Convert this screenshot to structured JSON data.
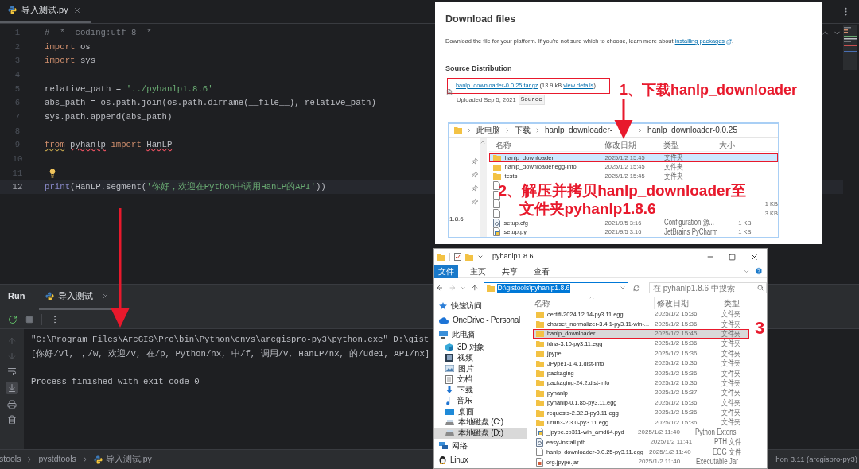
{
  "editor": {
    "tab": {
      "label": "导入测试.py"
    },
    "lines": [
      {
        "number": "1",
        "current": false,
        "hint": false,
        "tokens": [
          {
            "kind": "comment",
            "text": "# -*- coding:utf-8 -*-"
          }
        ]
      },
      {
        "number": "2",
        "current": false,
        "hint": false,
        "tokens": [
          {
            "kind": "keyword",
            "text": "import"
          },
          {
            "kind": "plain",
            "text": " os"
          }
        ]
      },
      {
        "number": "3",
        "current": false,
        "hint": false,
        "tokens": [
          {
            "kind": "keyword",
            "text": "import"
          },
          {
            "kind": "plain",
            "text": " sys"
          }
        ]
      },
      {
        "number": "4",
        "current": false,
        "hint": false
      },
      {
        "number": "5",
        "current": false,
        "hint": false,
        "tokens": [
          {
            "kind": "plain",
            "text": "relative_path = "
          },
          {
            "kind": "string",
            "text": "'../pyhanlp1.8.6'"
          }
        ]
      },
      {
        "number": "6",
        "current": false,
        "hint": false,
        "tokens": [
          {
            "kind": "plain",
            "text": "abs_path = os.path.join(os.path.dirname(__file__), relative_path)"
          }
        ]
      },
      {
        "number": "7",
        "current": false,
        "hint": false,
        "tokens": [
          {
            "kind": "plain",
            "text": "sys.path.append(abs_path)"
          }
        ]
      },
      {
        "number": "8",
        "current": false,
        "hint": false
      },
      {
        "number": "9",
        "current": false,
        "hint": false,
        "tokens": [
          {
            "kind": "keyword_warning",
            "text": "from"
          },
          {
            "kind": "plain_error",
            "text": "pyhanlp"
          },
          {
            "kind": "keyword",
            "text": " import "
          },
          {
            "kind": "plain_error",
            "text": "HanLP"
          }
        ]
      },
      {
        "number": "10",
        "current": false,
        "hint": false
      },
      {
        "number": "11",
        "current": false,
        "hint": true
      },
      {
        "number": "12",
        "current": true,
        "hint": false,
        "tokens": [
          {
            "kind": "builtin",
            "text": "print"
          },
          {
            "kind": "plain",
            "text": "(HanLP.segment("
          },
          {
            "kind": "string",
            "text": "'你好，欢迎在Python中调用HanLP的API'"
          },
          {
            "kind": "plain",
            "text": "))"
          }
        ]
      }
    ]
  },
  "run_panel": {
    "title": "Run",
    "tab": {
      "label": "导入测试"
    },
    "output": [
      {
        "kind": "command",
        "text": "\"C:\\Program Files\\ArcGIS\\Pro\\bin\\Python\\envs\\arcgispro-py3\\python.exe\" D:\\gist"
      },
      {
        "kind": "result",
        "text": "[你好/vl, ，/w, 欢迎/v, 在/p, Python/nx, 中/f, 调用/v, HanLP/nx, 的/ude1, API/nx]"
      },
      {
        "kind": "status",
        "text": "Process finished with exit code 0"
      }
    ]
  },
  "status_bar": {
    "breadcrumbs": [
      "stools",
      "pystdtools",
      "导入测试.py"
    ],
    "interpreter": "hon 3.11 (arcgispro-py3)"
  },
  "download_page": {
    "heading": "Download files",
    "intro": "Download the file for your platform. If you're not sure which to choose, learn more about",
    "intro_link": "installing packages",
    "intro_end": ".",
    "section": "Source Distribution",
    "file": {
      "link": "hanlp_downloader-0.0.25.tar.gz",
      "size": "(13.9 kB",
      "details_link": "view details",
      "close": ")",
      "uploaded": "Uploaded Sep 5, 2021",
      "tag": "Source"
    }
  },
  "extracted_folder": {
    "breadcrumbs": [
      "此电脑",
      "下载",
      "hanlp_downloader-",
      "hanlp_downloader-0.0.25"
    ],
    "sidebar_text": "1.8.6",
    "columns": [
      "名称",
      "修改日期",
      "类型",
      "大小"
    ],
    "rows": [
      {
        "kind": "folder",
        "selected": true,
        "highlighted": true,
        "name": "hanlp_downloader",
        "date": "2025/1/2 15:45",
        "type": "文件夹"
      },
      {
        "kind": "folder",
        "selected": false,
        "highlighted": false,
        "name": "hanlp_downloader.egg-info",
        "date": "2025/1/2 15:45",
        "type": "文件夹"
      },
      {
        "kind": "folder",
        "selected": false,
        "highlighted": false,
        "name": "tests",
        "date": "2025/1/2 15:45",
        "type": "文件夹"
      },
      {
        "kind": "file"
      },
      {
        "kind": "file"
      },
      {
        "kind": "file",
        "size": "1 KB"
      },
      {
        "kind": "file",
        "size": "3 KB"
      },
      {
        "kind": "config",
        "selected": false,
        "highlighted": false,
        "name": "setup.cfg",
        "date": "2021/9/5 3:16",
        "type": "Configuration 源...",
        "size": "1 KB"
      },
      {
        "kind": "python",
        "selected": false,
        "highlighted": false,
        "name": "setup.py",
        "date": "2021/9/5 3:16",
        "type": "JetBrains PyCharm",
        "size": "1 KB"
      }
    ]
  },
  "explorer": {
    "title": "pyhanlp1.8.6",
    "ribbon_tabs": [
      {
        "label": "文件",
        "selected": true
      },
      {
        "label": "主页",
        "selected": false
      },
      {
        "label": "共享",
        "selected": false
      },
      {
        "label": "查看",
        "selected": false
      }
    ],
    "address": "D:\\gistools\\pyhanlp1.8.6",
    "search": {
      "placeholder": "在 pyhanlp1.8.6 中搜索"
    },
    "navigation": [
      {
        "kind": "quick",
        "label": "快速访问",
        "selected": false
      },
      {
        "kind": "cloud",
        "label": "OneDrive - Personal",
        "selected": false
      },
      {
        "kind": "pc",
        "label": "此电脑",
        "selected": false,
        "children": [
          {
            "kind": "cube",
            "label": "3D 对象",
            "selected": false
          },
          {
            "kind": "video",
            "label": "视频",
            "selected": false
          },
          {
            "kind": "picture",
            "label": "图片",
            "selected": false
          },
          {
            "kind": "document",
            "label": "文档",
            "selected": false
          },
          {
            "kind": "download",
            "label": "下载",
            "selected": false
          },
          {
            "kind": "music",
            "label": "音乐",
            "selected": false
          },
          {
            "kind": "desktop",
            "label": "桌面",
            "selected": false
          },
          {
            "kind": "drive",
            "label": "本地磁盘 (C:)",
            "selected": false
          },
          {
            "kind": "drive",
            "label": "本地磁盘 (D:)",
            "selected": true
          }
        ]
      },
      {
        "kind": "network",
        "label": "网络",
        "selected": false
      },
      {
        "kind": "linux",
        "label": "Linux",
        "selected": false
      }
    ],
    "columns": [
      "名称",
      "修改日期",
      "类型"
    ],
    "rows": [
      {
        "kind": "folder",
        "selected": false,
        "highlighted": false,
        "name": "certifi-2024.12.14-py3.11.egg",
        "date": "2025/1/2 15:36",
        "type": "文件夹"
      },
      {
        "kind": "folder",
        "selected": false,
        "highlighted": false,
        "name": "charset_normalizer-3.4.1-py3.11-win-...",
        "date": "2025/1/2 15:36",
        "type": "文件夹"
      },
      {
        "kind": "folder",
        "selected": true,
        "highlighted": true,
        "name": "hanlp_downloader",
        "date": "2025/1/2 15:45",
        "type": "文件夹"
      },
      {
        "kind": "folder",
        "selected": false,
        "highlighted": false,
        "name": "idna-3.10-py3.11.egg",
        "date": "2025/1/2 15:36",
        "type": "文件夹"
      },
      {
        "kind": "folder",
        "selected": false,
        "highlighted": false,
        "name": "jpype",
        "date": "2025/1/2 15:36",
        "type": "文件夹"
      },
      {
        "kind": "folder",
        "selected": false,
        "highlighted": false,
        "name": "JPype1-1.4.1.dist-info",
        "date": "2025/1/2 15:36",
        "type": "文件夹"
      },
      {
        "kind": "folder",
        "selected": false,
        "highlighted": false,
        "name": "packaging",
        "date": "2025/1/2 15:36",
        "type": "文件夹"
      },
      {
        "kind": "folder",
        "selected": false,
        "highlighted": false,
        "name": "packaging-24.2.dist-info",
        "date": "2025/1/2 15:36",
        "type": "文件夹"
      },
      {
        "kind": "folder",
        "selected": false,
        "highlighted": false,
        "name": "pyhanlp",
        "date": "2025/1/2 15:37",
        "type": "文件夹"
      },
      {
        "kind": "folder",
        "selected": false,
        "highlighted": false,
        "name": "pyhanlp-0.1.85-py3.11.egg",
        "date": "2025/1/2 15:36",
        "type": "文件夹"
      },
      {
        "kind": "folder",
        "selected": false,
        "highlighted": false,
        "name": "requests-2.32.3-py3.11.egg",
        "date": "2025/1/2 15:36",
        "type": "文件夹"
      },
      {
        "kind": "folder",
        "selected": false,
        "highlighted": false,
        "name": "urllib3-2.3.0-py3.11.egg",
        "date": "2025/1/2 15:36",
        "type": "文件夹"
      },
      {
        "kind": "python",
        "selected": false,
        "highlighted": false,
        "name": "_jpype.cp311-win_amd64.pyd",
        "date": "2025/1/2 11:40",
        "type": "Python Extensi"
      },
      {
        "kind": "config",
        "selected": false,
        "highlighted": false,
        "name": "easy-install.pth",
        "date": "2025/1/2 11:41",
        "type": "PTH 文件"
      },
      {
        "kind": "file",
        "selected": false,
        "highlighted": false,
        "name": "hanlp_downloader-0.0.25-py3.11.egg",
        "date": "2025/1/2 11:40",
        "type": "EGG 文件"
      },
      {
        "kind": "jar",
        "selected": false,
        "highlighted": false,
        "name": "org.jpype.jar",
        "date": "2025/1/2 11:40",
        "type": "Executable Jar"
      }
    ]
  },
  "annotations": [
    {
      "kind": "step",
      "lines": [
        "1、下载hanlp_downloader"
      ]
    },
    {
      "kind": "step",
      "lines": [
        "2、解压并拷贝hanlp_downloader至",
        "文件夹pyhanlp1.8.6"
      ]
    },
    {
      "kind": "marker",
      "lines": [
        "3"
      ]
    }
  ]
}
